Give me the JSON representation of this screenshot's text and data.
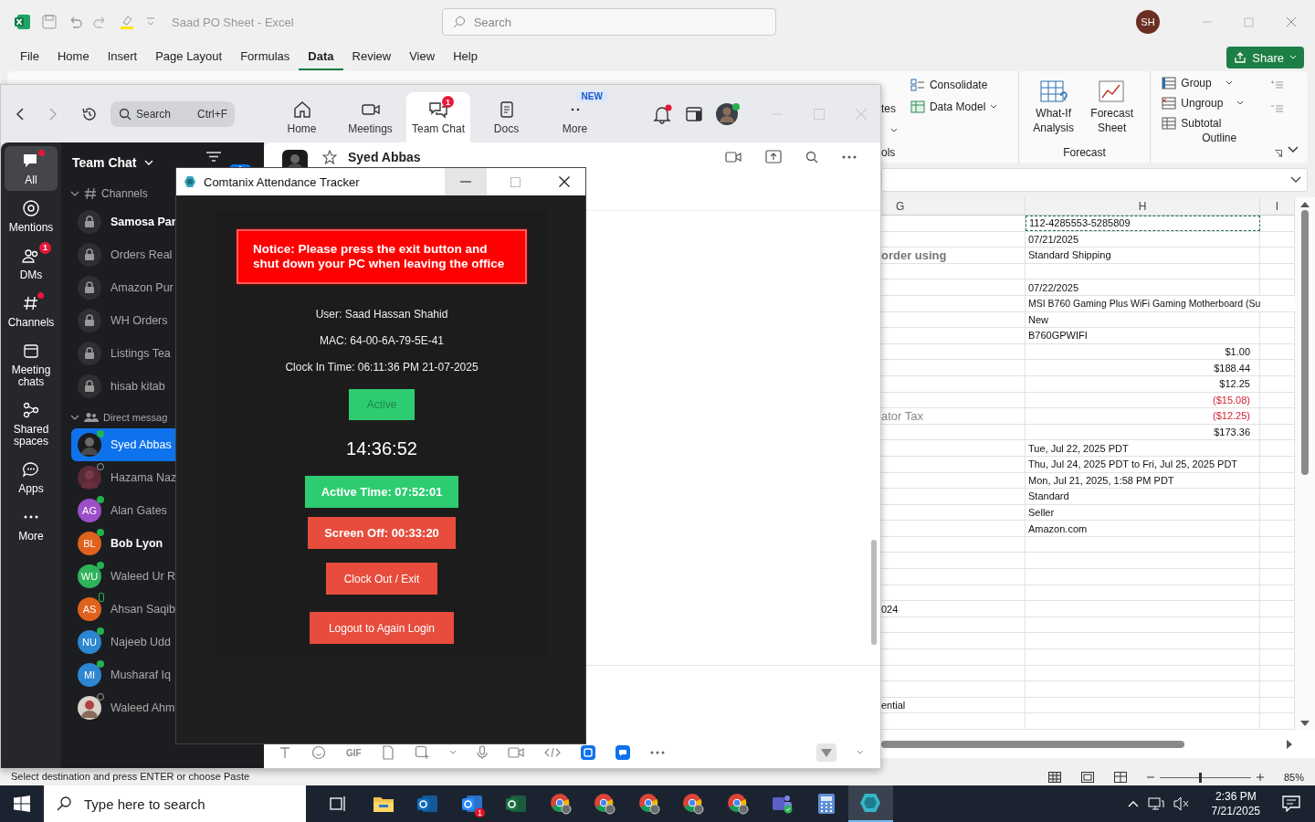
{
  "excel": {
    "title": "Saad PO Sheet - Excel",
    "search": {
      "placeholder": "Search"
    },
    "user_initials": "SH",
    "menu_tabs": [
      {
        "label": "File",
        "selected": false
      },
      {
        "label": "Home",
        "selected": false
      },
      {
        "label": "Insert",
        "selected": false
      },
      {
        "label": "Page Layout",
        "selected": false
      },
      {
        "label": "Formulas",
        "selected": false
      },
      {
        "label": "Data",
        "selected": true
      },
      {
        "label": "Review",
        "selected": false
      },
      {
        "label": "View",
        "selected": false
      },
      {
        "label": "Help",
        "selected": false
      }
    ],
    "share_label": "Share",
    "ribbon": {
      "partial_labels": [
        "tes",
        "ols"
      ],
      "data_tools": [
        {
          "label": "Consolidate",
          "kind": "consolidate"
        },
        {
          "label": "Data Model",
          "kind": "model"
        }
      ],
      "forecast": {
        "buttons": [
          {
            "label": "What-If Analysis",
            "kind": "whatif"
          },
          {
            "label": "Forecast Sheet",
            "kind": "chart"
          }
        ],
        "group_label": "Forecast"
      },
      "outline": {
        "items": [
          {
            "label": "Group",
            "kind": "group"
          },
          {
            "label": "Ungroup",
            "kind": "ungroup"
          },
          {
            "label": "Subtotal",
            "kind": "subtotal"
          }
        ],
        "group_label": "Outline"
      }
    },
    "columns": [
      "G",
      "H",
      "I"
    ],
    "rows": [
      {
        "h": "112-4285553-5285809",
        "kind": "text",
        "selected": true
      },
      {
        "h": "07/21/2025",
        "kind": "text",
        "selected": false
      },
      {
        "g": {
          "text": "order using",
          "kind": "heading"
        },
        "h": "Standard Shipping",
        "kind": "text",
        "selected": false
      },
      {
        "selected": false
      },
      {
        "h": "07/22/2025",
        "kind": "text",
        "selected": false
      },
      {
        "h": "MSI B760 Gaming Plus WiFi Gaming Motherboard (Su",
        "kind": "long",
        "selected": false
      },
      {
        "h": "New",
        "kind": "text",
        "selected": false
      },
      {
        "h": "B760GPWIFI",
        "kind": "text",
        "selected": false
      },
      {
        "h": "$1.00",
        "kind": "amount",
        "selected": false
      },
      {
        "h": "$188.44",
        "kind": "amount",
        "selected": false
      },
      {
        "h": "$12.25",
        "kind": "amount",
        "selected": false
      },
      {
        "h": "($15.08)",
        "kind": "negative",
        "selected": false
      },
      {
        "g": {
          "text": "ator Tax",
          "kind": "faded"
        },
        "h": "($12.25)",
        "kind": "negative",
        "selected": false
      },
      {
        "h": "$173.36",
        "kind": "amount",
        "selected": false
      },
      {
        "h": "Tue, Jul 22, 2025 PDT",
        "kind": "text",
        "selected": false
      },
      {
        "h": "Thu, Jul 24, 2025 PDT to Fri, Jul 25, 2025 PDT",
        "kind": "text",
        "selected": false
      },
      {
        "h": "Mon, Jul 21, 2025, 1:58 PM PDT",
        "kind": "text",
        "selected": false
      },
      {
        "h": "Standard",
        "kind": "text",
        "selected": false
      },
      {
        "h": "Seller",
        "kind": "text",
        "selected": false
      },
      {
        "h": "Amazon.com",
        "kind": "text",
        "selected": false
      },
      {
        "selected": false
      },
      {
        "selected": false
      },
      {
        "selected": false
      },
      {
        "selected": false
      },
      {
        "g": {
          "text": "024",
          "kind": "plain"
        },
        "selected": false
      },
      {
        "selected": false
      },
      {
        "selected": false
      },
      {
        "selected": false
      },
      {
        "selected": false
      },
      {
        "selected": false
      },
      {
        "g": {
          "text": "ential",
          "kind": "plain"
        },
        "selected": false
      },
      {
        "selected": false
      }
    ],
    "status": "Select destination and press ENTER or choose Paste",
    "zoom_slider": {
      "level": 0.43
    },
    "zoom": "85%"
  },
  "zoom_app": {
    "search": {
      "placeholder": "Search",
      "shortcut": "Ctrl+F"
    },
    "tabs": [
      {
        "label": "Home",
        "kind": "home",
        "selected": false
      },
      {
        "label": "Meetings",
        "kind": "video",
        "selected": false
      },
      {
        "label": "Team Chat",
        "kind": "chat",
        "selected": true,
        "badge": "1"
      },
      {
        "label": "Docs",
        "kind": "doc",
        "selected": false
      },
      {
        "label": "More",
        "kind": "dots",
        "selected": false,
        "badge": "NEW"
      }
    ],
    "rail": [
      {
        "label": "All",
        "kind": "chat",
        "selected": true,
        "unread": true
      },
      {
        "label": "Mentions",
        "kind": "at",
        "selected": false,
        "unread": false
      },
      {
        "label": "DMs",
        "kind": "people",
        "selected": false,
        "unread": false,
        "badge": "1"
      },
      {
        "label": "Channels",
        "kind": "hash",
        "selected": false,
        "unread": true
      },
      {
        "label": "Meeting chats",
        "kind": "calendar",
        "selected": false,
        "unread": false
      },
      {
        "label": "Shared spaces",
        "kind": "share",
        "selected": false,
        "unread": false
      },
      {
        "label": "Apps",
        "kind": "bubble",
        "selected": false,
        "unread": false
      },
      {
        "label": "More",
        "kind": "dots",
        "selected": false,
        "unread": false
      }
    ],
    "chat_list": {
      "title": "Team Chat",
      "channels_label": "Channels",
      "channels": [
        {
          "name": "Samosa Par",
          "unread": true
        },
        {
          "name": "Orders Real",
          "unread": false
        },
        {
          "name": "Amazon Pur",
          "unread": false
        },
        {
          "name": "WH Orders",
          "unread": false
        },
        {
          "name": "Listings Tea",
          "unread": false
        },
        {
          "name": "hisab kitab",
          "unread": false
        }
      ],
      "dm_label": "Direct messag",
      "dms": [
        {
          "name": "Syed Abbas",
          "kind": "photo",
          "online": true,
          "mobile": false,
          "selected": true,
          "unread": false
        },
        {
          "name": "Hazama Naz",
          "kind": "photo",
          "online": false,
          "mobile": false,
          "selected": false,
          "unread": false
        },
        {
          "name": "Alan Gates",
          "kind": "initials",
          "initials": "AG",
          "color": "#9b4fc9",
          "online": true,
          "mobile": false,
          "selected": false,
          "unread": false
        },
        {
          "name": "Bob Lyon",
          "kind": "initials",
          "initials": "BL",
          "color": "#e0621c",
          "online": true,
          "mobile": false,
          "selected": false,
          "unread": true
        },
        {
          "name": "Waleed Ur R",
          "kind": "initials",
          "initials": "WU",
          "color": "#2fb25a",
          "online": true,
          "mobile": false,
          "selected": false,
          "unread": false
        },
        {
          "name": "Ahsan Saqib",
          "kind": "initials",
          "initials": "AS",
          "color": "#e0621c",
          "online": true,
          "mobile": true,
          "selected": false,
          "unread": false
        },
        {
          "name": "Najeeb Udd",
          "kind": "initials",
          "initials": "NU",
          "color": "#2d86d1",
          "online": true,
          "mobile": false,
          "selected": false,
          "unread": false
        },
        {
          "name": "Musharaf Iq",
          "kind": "initials",
          "initials": "MI",
          "color": "#2d86d1",
          "online": true,
          "mobile": false,
          "selected": false,
          "unread": false
        },
        {
          "name": "Waleed Ahm",
          "kind": "photo",
          "online": false,
          "mobile": false,
          "selected": false,
          "unread": false
        }
      ]
    },
    "chat": {
      "title": "Syed Abbas",
      "composer_tools": [
        {
          "kind": "text"
        },
        {
          "kind": "emoji"
        },
        {
          "kind": "gif",
          "label": "GIF"
        },
        {
          "kind": "file"
        },
        {
          "kind": "screenshot"
        },
        {
          "kind": "caret"
        },
        {
          "kind": "mic"
        },
        {
          "kind": "video"
        },
        {
          "kind": "code"
        },
        {
          "kind": "app"
        },
        {
          "kind": "message"
        },
        {
          "kind": "more"
        }
      ]
    }
  },
  "tracker": {
    "title": "Comtanix Attendance Tracker",
    "notice": "Notice: Please press the exit button and shut down your PC when leaving the office",
    "user": "User: Saad Hassan Shahid",
    "mac": "MAC: 64-00-6A-79-5E-41",
    "clock_in": "Clock In Time: 06:11:36 PM 21-07-2025",
    "status": "Active",
    "clock": "14:36:52",
    "active_time": "Active Time: 07:52:01",
    "screen_off": "Screen Off: 00:33:20",
    "buttons": [
      "Clock Out / Exit",
      "Logout to Again Login"
    ]
  },
  "taskbar": {
    "search": {
      "placeholder": "Type here to search"
    },
    "apps": [
      {
        "kind": "task-view",
        "active": false
      },
      {
        "kind": "folder",
        "active": false
      },
      {
        "kind": "outlook",
        "active": false
      },
      {
        "kind": "zoom",
        "active": false,
        "badge": "1"
      },
      {
        "kind": "excel",
        "active": false
      },
      {
        "kind": "chrome",
        "active": false
      },
      {
        "kind": "chrome",
        "active": false
      },
      {
        "kind": "chrome",
        "active": false
      },
      {
        "kind": "chrome",
        "active": false
      },
      {
        "kind": "chrome",
        "active": false
      },
      {
        "kind": "teams",
        "active": false
      },
      {
        "kind": "calculator",
        "active": false
      },
      {
        "kind": "tracker",
        "active": true
      }
    ],
    "time": "2:36 PM",
    "date": "7/21/2025"
  }
}
